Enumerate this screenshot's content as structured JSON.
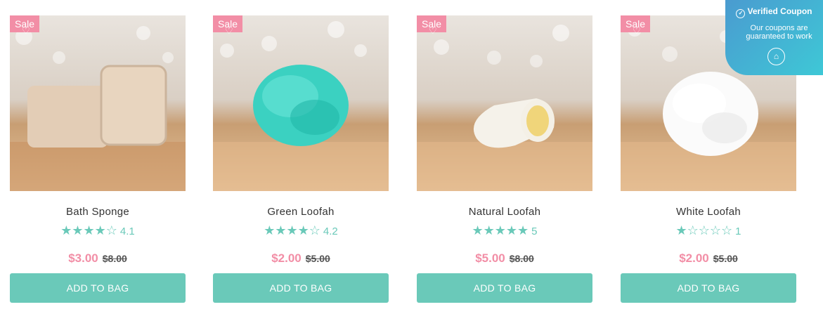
{
  "products": [
    {
      "name": "Bath Sponge",
      "badge": "Sale",
      "stars": "★★★★☆",
      "rating": "4.1",
      "price": "$3.00",
      "was": "$8.00",
      "cta": "ADD TO BAG"
    },
    {
      "name": "Green Loofah",
      "badge": "Sale",
      "stars": "★★★★☆",
      "rating": "4.2",
      "price": "$2.00",
      "was": "$5.00",
      "cta": "ADD TO BAG"
    },
    {
      "name": "Natural Loofah",
      "badge": "Sale",
      "stars": "★★★★★",
      "rating": "5",
      "price": "$5.00",
      "was": "$8.00",
      "cta": "ADD TO BAG"
    },
    {
      "name": "White Loofah",
      "badge": "Sale",
      "stars": "★☆☆☆☆",
      "rating": "1",
      "price": "$2.00",
      "was": "$5.00",
      "cta": "ADD TO BAG"
    }
  ],
  "coupon": {
    "title": "Verified Coupon",
    "desc": "Our coupons are guaranteed to work"
  },
  "colors": {
    "accent": "#6ac9b9",
    "sale": "#f28ea6",
    "coupon": "#3ec8d6"
  },
  "icons": {
    "favorite": "heart-outline-icon",
    "verified": "check-circle-icon",
    "coupon": "tag-icon"
  }
}
